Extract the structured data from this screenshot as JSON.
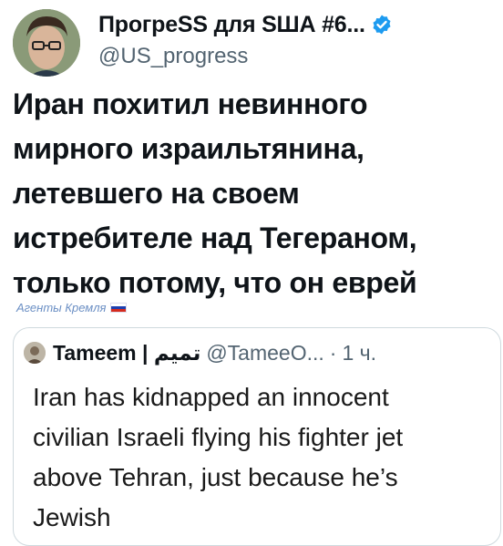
{
  "tweet": {
    "author": {
      "display_name": "ПрогреSS для SША #6...",
      "handle": "@US_progress",
      "verified": true,
      "verified_color": "#1d9bf0"
    },
    "text_lines": [
      "Иран похитил невинного",
      "мирного израильтянина,",
      "летевшего на своем",
      "истребителе над Тегераном,",
      "только потому, что он еврей"
    ]
  },
  "watermark": {
    "text": "Агенты Кремля",
    "icon": "russia-flag-icon"
  },
  "quoted_tweet": {
    "author_name": "Tameem | تميم",
    "handle": "@TameeO...",
    "separator": "·",
    "time": "1 ч.",
    "text_lines": [
      "Iran has kidnapped an innocent",
      "civilian Israeli flying his fighter jet",
      "above Tehran, just because he’s",
      "Jewish"
    ]
  }
}
